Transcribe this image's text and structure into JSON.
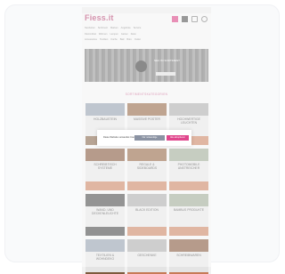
{
  "site": {
    "logo_text": "Fiess.it"
  },
  "nav": {
    "row1": [
      "Neuheiten",
      "Sortiment",
      "Marken",
      "Angebote",
      "Service"
    ],
    "row2": [
      "Kleinmöbel",
      "Wohnen",
      "Lampen",
      "Garten",
      "Deko"
    ],
    "row3": [
      "Accessoires",
      "Textilien",
      "Küche",
      "Bad",
      "Büro",
      "Outlet"
    ]
  },
  "hero": {
    "text": "NEU IM SORTIMENT"
  },
  "section": {
    "title": "SORTIMENTSKATEGORIEN"
  },
  "categories": [
    {
      "label": "HOLZBAUSTEIN",
      "style": "blue"
    },
    {
      "label": "MASSIVE POSTER",
      "style": "wood"
    },
    {
      "label": "HOCHWERTIGE LEUCHTEN",
      "style": "grey"
    },
    {
      "label": "SCHREIBTISCH SYSTEME",
      "style": "brown"
    },
    {
      "label": "REGALE & SIDEBOARDS",
      "style": "wood"
    },
    {
      "label": "PHOTOMOBILE ANSTREICHER",
      "style": "sage"
    },
    {
      "label": "WAND- UND DECKENLEUCHTE",
      "style": "dark"
    },
    {
      "label": "BLACK EDITION",
      "style": "grey"
    },
    {
      "label": "BAMBUS PRODUKTE",
      "style": "sage"
    },
    {
      "label": "TEXTILIEN & WOHNDEKO",
      "style": "blue"
    },
    {
      "label": "GESCHENKE",
      "style": "grey"
    },
    {
      "label": "SCHREIBWAREN",
      "style": "brown"
    }
  ],
  "cookie_banner": {
    "text": "Diese Website verwendet Cookies.",
    "necessary_label": "Nur notwendige",
    "accept_label": "Alle akzeptieren"
  }
}
